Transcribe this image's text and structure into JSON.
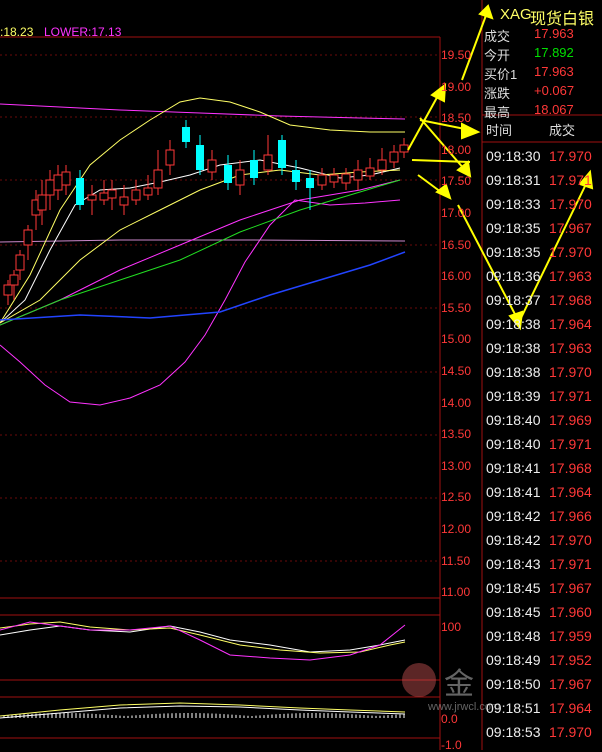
{
  "header": {
    "mid_label": ":18.23",
    "lower_label": "LOWER:17.13"
  },
  "price_axis": [
    "19.50",
    "19.00",
    "18.50",
    "18.00",
    "17.50",
    "17.00",
    "16.50",
    "16.00",
    "15.50",
    "15.00",
    "14.50",
    "14.00",
    "13.50",
    "13.00",
    "12.50",
    "12.00",
    "11.50",
    "11.00"
  ],
  "ind_axis": [
    "100",
    "0.0",
    "-1.0"
  ],
  "quote": {
    "code": "XAG",
    "name": "现货白银",
    "rows": [
      {
        "label": "成交",
        "value": "17.963",
        "color": "red"
      },
      {
        "label": "今开",
        "value": "17.892",
        "color": "green"
      },
      {
        "label": "买价1",
        "value": "17.963",
        "color": "red"
      },
      {
        "label": "涨跌",
        "value": "+0.067",
        "color": "red"
      },
      {
        "label": "最高",
        "value": "18.067",
        "color": "red"
      }
    ]
  },
  "trades_header": {
    "time": "时间",
    "price": "成交"
  },
  "trades": [
    {
      "time": "09:18:30",
      "price": "17.970"
    },
    {
      "time": "09:18:31",
      "price": "17.971"
    },
    {
      "time": "09:18:33",
      "price": "17.970"
    },
    {
      "time": "09:18:35",
      "price": "17.967"
    },
    {
      "time": "09:18:35",
      "price": "17.970"
    },
    {
      "time": "09:18:36",
      "price": "17.963"
    },
    {
      "time": "09:18:37",
      "price": "17.968"
    },
    {
      "time": "09:18:38",
      "price": "17.964"
    },
    {
      "time": "09:18:38",
      "price": "17.963"
    },
    {
      "time": "09:18:38",
      "price": "17.970"
    },
    {
      "time": "09:18:39",
      "price": "17.971"
    },
    {
      "time": "09:18:40",
      "price": "17.969"
    },
    {
      "time": "09:18:40",
      "price": "17.971"
    },
    {
      "time": "09:18:41",
      "price": "17.968"
    },
    {
      "time": "09:18:41",
      "price": "17.964"
    },
    {
      "time": "09:18:42",
      "price": "17.966"
    },
    {
      "time": "09:18:42",
      "price": "17.970"
    },
    {
      "time": "09:18:43",
      "price": "17.971"
    },
    {
      "time": "09:18:45",
      "price": "17.967"
    },
    {
      "time": "09:18:45",
      "price": "17.960"
    },
    {
      "time": "09:18:48",
      "price": "17.959"
    },
    {
      "time": "09:18:49",
      "price": "17.952"
    },
    {
      "time": "09:18:50",
      "price": "17.967"
    },
    {
      "time": "09:18:51",
      "price": "17.964"
    },
    {
      "time": "09:18:53",
      "price": "17.970"
    }
  ],
  "watermark": {
    "brand": "金",
    "url": "www.jrwcl.com"
  },
  "colors": {
    "up": "#ff3838",
    "down": "#00ffff",
    "grid": "#a01010",
    "ma_white": "#ffffff",
    "ma_yellow": "#ffff66",
    "ma_magenta": "#ff33ff",
    "ma_green": "#22dd22",
    "ma_blue": "#2244ff",
    "arrow": "#ffff00"
  }
}
